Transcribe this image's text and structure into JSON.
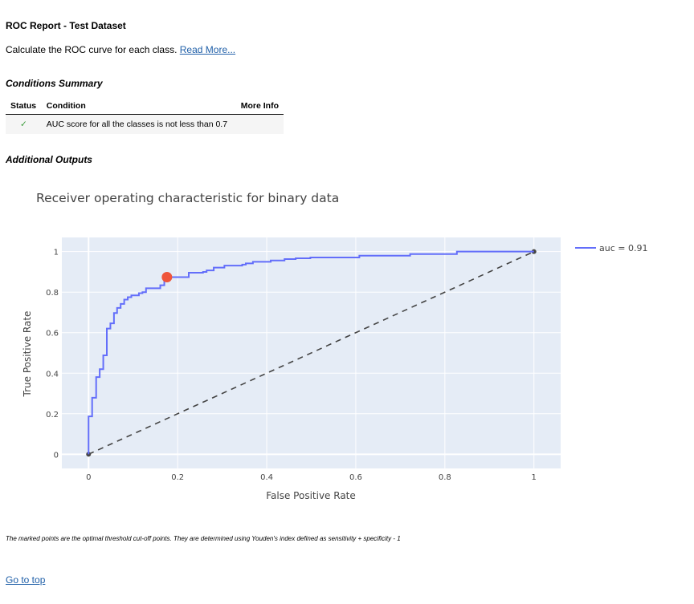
{
  "header": {
    "title": "ROC Report - Test Dataset",
    "description": "Calculate the ROC curve for each class.",
    "read_more": "Read More..."
  },
  "conditions": {
    "heading": "Conditions Summary",
    "columns": [
      "Status",
      "Condition",
      "More Info"
    ],
    "rows": [
      {
        "status": "✓",
        "status_color": "#3c9c3c",
        "condition": "AUC score for all the classes is not less than 0.7",
        "more_info": ""
      }
    ]
  },
  "additional_outputs": {
    "heading": "Additional Outputs"
  },
  "chart_data": {
    "type": "line",
    "title": "Receiver operating characteristic for binary data",
    "xlabel": "False Positive Rate",
    "ylabel": "True Positive Rate",
    "xlim": [
      -0.06,
      1.06
    ],
    "ylim": [
      -0.07,
      1.07
    ],
    "xticks": [
      "0",
      "0.2",
      "0.4",
      "0.6",
      "0.8",
      "1"
    ],
    "yticks": [
      "0",
      "0.2",
      "0.4",
      "0.6",
      "0.8",
      "1"
    ],
    "grid": true,
    "legend_placement": "top-right",
    "series": [
      {
        "name": "auc = 0.91",
        "color": "#636EFA",
        "shape": "step",
        "x": [
          0,
          0,
          0.008,
          0.017,
          0.025,
          0.033,
          0.041,
          0.049,
          0.057,
          0.064,
          0.072,
          0.08,
          0.088,
          0.096,
          0.113,
          0.121,
          0.129,
          0.161,
          0.17,
          0.225,
          0.257,
          0.265,
          0.281,
          0.305,
          0.345,
          0.353,
          0.369,
          0.409,
          0.44,
          0.465,
          0.498,
          0.608,
          0.722,
          0.827,
          1
        ],
        "y": [
          0,
          0.187,
          0.279,
          0.381,
          0.42,
          0.488,
          0.62,
          0.646,
          0.697,
          0.722,
          0.742,
          0.763,
          0.775,
          0.784,
          0.795,
          0.8,
          0.819,
          0.834,
          0.874,
          0.896,
          0.9,
          0.907,
          0.921,
          0.931,
          0.936,
          0.942,
          0.95,
          0.956,
          0.963,
          0.967,
          0.971,
          0.98,
          0.988,
          1.0,
          1.0
        ]
      }
    ],
    "baseline": {
      "x": [
        0,
        1
      ],
      "y": [
        0,
        1
      ],
      "color": "#444444",
      "style": "dashed"
    },
    "optimal_point": {
      "x": 0.176,
      "y": 0.874,
      "color": "#EF553B"
    }
  },
  "footer": {
    "note": "The marked points are the optimal threshold cut-off points. They are determined using Youden's index defined as sensitivity + specificity - 1",
    "go_to_top": "Go to top"
  }
}
